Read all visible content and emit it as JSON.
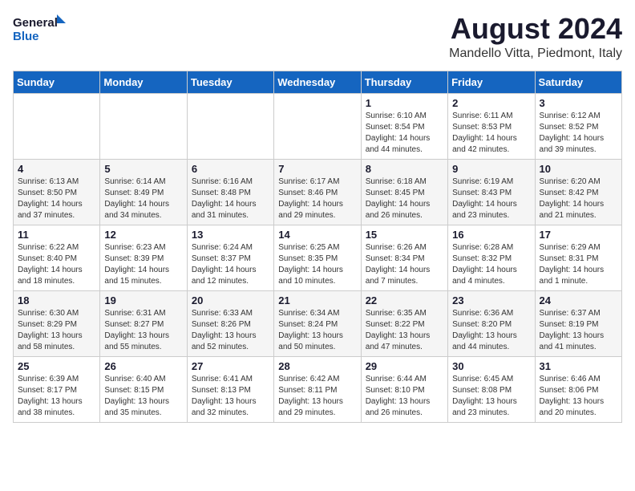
{
  "logo": {
    "line1": "General",
    "line2": "Blue"
  },
  "title": {
    "month_year": "August 2024",
    "location": "Mandello Vitta, Piedmont, Italy"
  },
  "headers": [
    "Sunday",
    "Monday",
    "Tuesday",
    "Wednesday",
    "Thursday",
    "Friday",
    "Saturday"
  ],
  "weeks": [
    [
      {
        "day": "",
        "info": ""
      },
      {
        "day": "",
        "info": ""
      },
      {
        "day": "",
        "info": ""
      },
      {
        "day": "",
        "info": ""
      },
      {
        "day": "1",
        "info": "Sunrise: 6:10 AM\nSunset: 8:54 PM\nDaylight: 14 hours\nand 44 minutes."
      },
      {
        "day": "2",
        "info": "Sunrise: 6:11 AM\nSunset: 8:53 PM\nDaylight: 14 hours\nand 42 minutes."
      },
      {
        "day": "3",
        "info": "Sunrise: 6:12 AM\nSunset: 8:52 PM\nDaylight: 14 hours\nand 39 minutes."
      }
    ],
    [
      {
        "day": "4",
        "info": "Sunrise: 6:13 AM\nSunset: 8:50 PM\nDaylight: 14 hours\nand 37 minutes."
      },
      {
        "day": "5",
        "info": "Sunrise: 6:14 AM\nSunset: 8:49 PM\nDaylight: 14 hours\nand 34 minutes."
      },
      {
        "day": "6",
        "info": "Sunrise: 6:16 AM\nSunset: 8:48 PM\nDaylight: 14 hours\nand 31 minutes."
      },
      {
        "day": "7",
        "info": "Sunrise: 6:17 AM\nSunset: 8:46 PM\nDaylight: 14 hours\nand 29 minutes."
      },
      {
        "day": "8",
        "info": "Sunrise: 6:18 AM\nSunset: 8:45 PM\nDaylight: 14 hours\nand 26 minutes."
      },
      {
        "day": "9",
        "info": "Sunrise: 6:19 AM\nSunset: 8:43 PM\nDaylight: 14 hours\nand 23 minutes."
      },
      {
        "day": "10",
        "info": "Sunrise: 6:20 AM\nSunset: 8:42 PM\nDaylight: 14 hours\nand 21 minutes."
      }
    ],
    [
      {
        "day": "11",
        "info": "Sunrise: 6:22 AM\nSunset: 8:40 PM\nDaylight: 14 hours\nand 18 minutes."
      },
      {
        "day": "12",
        "info": "Sunrise: 6:23 AM\nSunset: 8:39 PM\nDaylight: 14 hours\nand 15 minutes."
      },
      {
        "day": "13",
        "info": "Sunrise: 6:24 AM\nSunset: 8:37 PM\nDaylight: 14 hours\nand 12 minutes."
      },
      {
        "day": "14",
        "info": "Sunrise: 6:25 AM\nSunset: 8:35 PM\nDaylight: 14 hours\nand 10 minutes."
      },
      {
        "day": "15",
        "info": "Sunrise: 6:26 AM\nSunset: 8:34 PM\nDaylight: 14 hours\nand 7 minutes."
      },
      {
        "day": "16",
        "info": "Sunrise: 6:28 AM\nSunset: 8:32 PM\nDaylight: 14 hours\nand 4 minutes."
      },
      {
        "day": "17",
        "info": "Sunrise: 6:29 AM\nSunset: 8:31 PM\nDaylight: 14 hours\nand 1 minute."
      }
    ],
    [
      {
        "day": "18",
        "info": "Sunrise: 6:30 AM\nSunset: 8:29 PM\nDaylight: 13 hours\nand 58 minutes."
      },
      {
        "day": "19",
        "info": "Sunrise: 6:31 AM\nSunset: 8:27 PM\nDaylight: 13 hours\nand 55 minutes."
      },
      {
        "day": "20",
        "info": "Sunrise: 6:33 AM\nSunset: 8:26 PM\nDaylight: 13 hours\nand 52 minutes."
      },
      {
        "day": "21",
        "info": "Sunrise: 6:34 AM\nSunset: 8:24 PM\nDaylight: 13 hours\nand 50 minutes."
      },
      {
        "day": "22",
        "info": "Sunrise: 6:35 AM\nSunset: 8:22 PM\nDaylight: 13 hours\nand 47 minutes."
      },
      {
        "day": "23",
        "info": "Sunrise: 6:36 AM\nSunset: 8:20 PM\nDaylight: 13 hours\nand 44 minutes."
      },
      {
        "day": "24",
        "info": "Sunrise: 6:37 AM\nSunset: 8:19 PM\nDaylight: 13 hours\nand 41 minutes."
      }
    ],
    [
      {
        "day": "25",
        "info": "Sunrise: 6:39 AM\nSunset: 8:17 PM\nDaylight: 13 hours\nand 38 minutes."
      },
      {
        "day": "26",
        "info": "Sunrise: 6:40 AM\nSunset: 8:15 PM\nDaylight: 13 hours\nand 35 minutes."
      },
      {
        "day": "27",
        "info": "Sunrise: 6:41 AM\nSunset: 8:13 PM\nDaylight: 13 hours\nand 32 minutes."
      },
      {
        "day": "28",
        "info": "Sunrise: 6:42 AM\nSunset: 8:11 PM\nDaylight: 13 hours\nand 29 minutes."
      },
      {
        "day": "29",
        "info": "Sunrise: 6:44 AM\nSunset: 8:10 PM\nDaylight: 13 hours\nand 26 minutes."
      },
      {
        "day": "30",
        "info": "Sunrise: 6:45 AM\nSunset: 8:08 PM\nDaylight: 13 hours\nand 23 minutes."
      },
      {
        "day": "31",
        "info": "Sunrise: 6:46 AM\nSunset: 8:06 PM\nDaylight: 13 hours\nand 20 minutes."
      }
    ]
  ]
}
